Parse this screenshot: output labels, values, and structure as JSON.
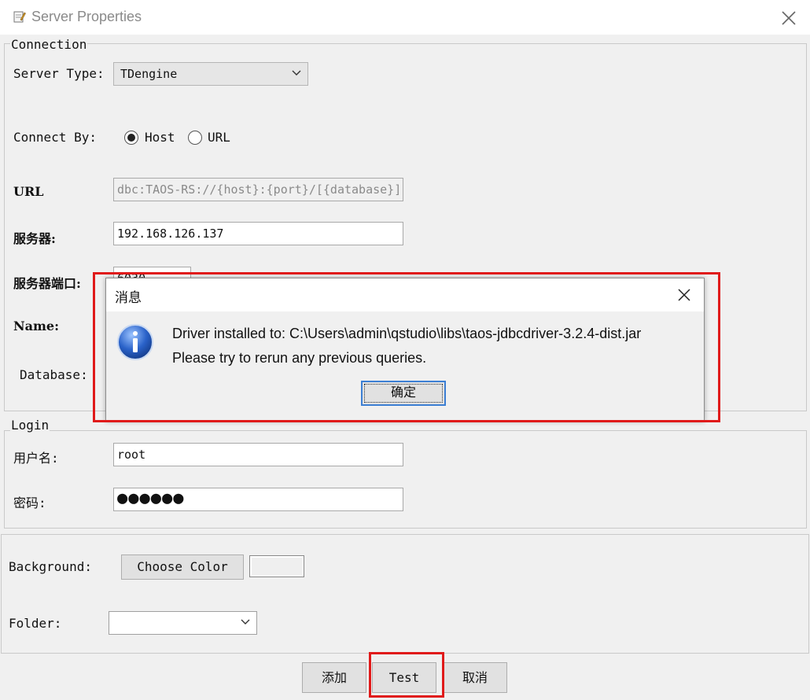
{
  "window": {
    "title": "Server Properties",
    "icon": "pencil-edit-icon"
  },
  "connection": {
    "legend": "Connection",
    "server_type_label": "Server Type:",
    "server_type_value": "TDengine",
    "connect_by_label": "Connect By:",
    "radio_host": "Host",
    "radio_url": "URL",
    "url_label": "URL",
    "url_value": "dbc:TAOS-RS://{host}:{port}/[{database}]",
    "server_label": "服务器:",
    "server_value": "192.168.126.137",
    "port_label": "服务器端口:",
    "port_value": "6030",
    "name_label": "Name:",
    "database_label": "Database:"
  },
  "login": {
    "legend": "Login",
    "username_label": "用户名:",
    "username_value": "root",
    "password_label": "密码:",
    "password_mask": "●●●●●●"
  },
  "appearance": {
    "background_label": "Background:",
    "choose_color_label": "Choose Color",
    "folder_label": "Folder:",
    "folder_value": ""
  },
  "footer": {
    "add_label": "添加",
    "test_label": "Test",
    "cancel_label": "取消"
  },
  "dialog": {
    "title": "消息",
    "line1": "Driver installed to: C:\\Users\\admin\\qstudio\\libs\\taos-jdbcdriver-3.2.4-dist.jar",
    "line2": "Please try to rerun any previous queries.",
    "ok_label": "确定",
    "icon": "info-icon"
  },
  "colors": {
    "highlight": "#e01a1a",
    "focus": "#3c7fd4",
    "info_blue": "#2a62c9"
  }
}
